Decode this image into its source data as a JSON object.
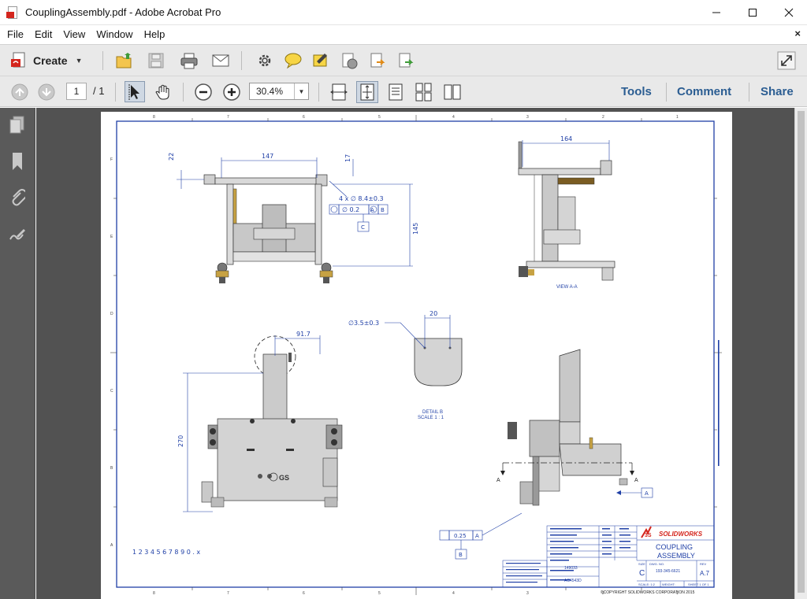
{
  "window": {
    "title": "CouplingAssembly.pdf - Adobe Acrobat Pro"
  },
  "menu": {
    "items": [
      "File",
      "Edit",
      "View",
      "Window",
      "Help"
    ],
    "close_doc": "×"
  },
  "toolbar": {
    "create_label": "Create",
    "page_current": "1",
    "page_total": "/ 1",
    "zoom": "30.4%",
    "tools_label": "Tools",
    "comment_label": "Comment",
    "share_label": "Share"
  },
  "drawing": {
    "top_left_view": {
      "dim_width": "147",
      "dim_left": "22",
      "dim_top": "17",
      "dim_height": "145",
      "hole_callout": "4 x ∅ 8.4±0.3",
      "fcf_tolerance": "∅ 0.2",
      "fcf_datum_a": "A",
      "fcf_datum_b": "B",
      "datum_c": "C"
    },
    "top_right_view": {
      "dim_width": "164",
      "caption": "VIEW A-A"
    },
    "detail": {
      "dia_callout": "∅3.5±0.3",
      "dim_width": "20",
      "caption": "DETAIL B",
      "scale": "SCALE 1 : 1"
    },
    "bottom_left_view": {
      "dim_width": "91.7",
      "dim_height": "270"
    },
    "bottom_right_view": {
      "section_label": "A",
      "datum_a": "A",
      "flatness_tol": "0.25",
      "flatness_datum": "A",
      "datum_b": "B"
    },
    "ruler_text": "1 2 3 4 5 6 7 8 9 0 . x",
    "title_block": {
      "logo_text": "SOLIDWORKS",
      "logo_prefix": "3S",
      "title_line1": "COUPLING",
      "title_line2": "ASSEMBLY",
      "size_label": "SIZE",
      "size": "C",
      "dwg_label": "DWG. NO.",
      "dwg_no": "193-345-6621",
      "rev_label": "REV",
      "rev": "A.7",
      "scale": "SCALE: 1:2",
      "weight": "WEIGHT:",
      "sheet": "SHEET 1 OF 1",
      "copyright": "©COPYRIGHT SOLIDWORKS CORPORATION 2015",
      "part_no_1": "149033",
      "part_no_2": "AC4543D"
    },
    "border_numbers_top": [
      "8",
      "7",
      "6",
      "5",
      "4",
      "3",
      "2",
      "1"
    ],
    "border_letters_side": [
      "F",
      "E",
      "D",
      "C",
      "B",
      "A"
    ]
  },
  "colors": {
    "dimension_blue": "#1f3fa6",
    "link_blue": "#2b5d92",
    "nav_gray": "#5a5a5a",
    "doc_bg": "#525252"
  }
}
